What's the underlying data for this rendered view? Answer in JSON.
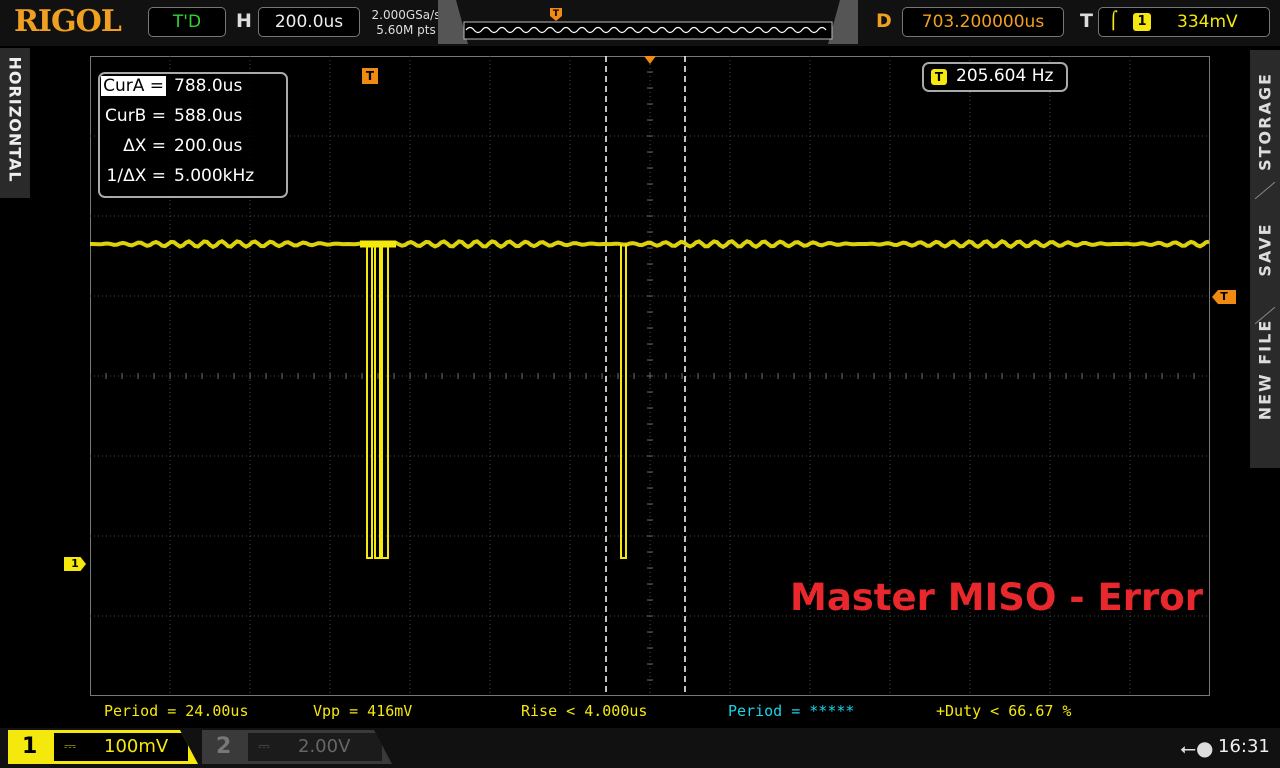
{
  "brand": "RIGOL",
  "run_status": "T'D",
  "horizontal": {
    "letter": "H",
    "timebase": "200.0us",
    "sample_rate": "2.000GSa/s",
    "memory_depth": "5.60M pts"
  },
  "delay": {
    "letter": "D",
    "value": "703.200000us"
  },
  "trigger": {
    "letter": "T",
    "slope_icon": "rising-edge-icon",
    "channel": "1",
    "level": "334mV"
  },
  "side_tabs": {
    "left": "HORIZONTAL",
    "right": [
      "STORAGE",
      "SAVE",
      "NEW FILE"
    ]
  },
  "cursors": [
    {
      "label": "CurA =",
      "value": "788.0us",
      "selected": true
    },
    {
      "label": "CurB =",
      "value": "588.0us",
      "selected": false
    },
    {
      "label": "ΔX =",
      "value": "200.0us",
      "selected": false
    },
    {
      "label": "1/ΔX =",
      "value": "5.000kHz",
      "selected": false
    }
  ],
  "frequency_counter": {
    "icon": "T",
    "value": "205.604 Hz"
  },
  "markers": {
    "trigger_position": "T",
    "channel": "1",
    "trigger_level": "T"
  },
  "annotation": "Master MISO - Error",
  "measurements": [
    {
      "text": "Period = 24.00us",
      "color": "#f4e80c"
    },
    {
      "text": "Vpp = 416mV",
      "color": "#f4e80c"
    },
    {
      "text": "Rise < 4.000us",
      "color": "#f4e80c"
    },
    {
      "text": "Period = *****",
      "color": "#19d4e8"
    },
    {
      "text": "+Duty < 66.67 %",
      "color": "#f4e80c"
    }
  ],
  "channels": [
    {
      "number": "1",
      "coupling": "DC",
      "scale": "100mV",
      "active": true,
      "color": "#f4e80c"
    },
    {
      "number": "2",
      "coupling": "DC",
      "scale": "2.00V",
      "active": false,
      "color": "#666666"
    }
  ],
  "status": {
    "usb_icon": "usb-icon",
    "time": "16:31"
  },
  "colors": {
    "ch1": "#f4e80c",
    "trigger": "#f08a10",
    "accent": "#f0a020",
    "ch2": "#19d4e8",
    "annotation": "#e8282c"
  }
}
